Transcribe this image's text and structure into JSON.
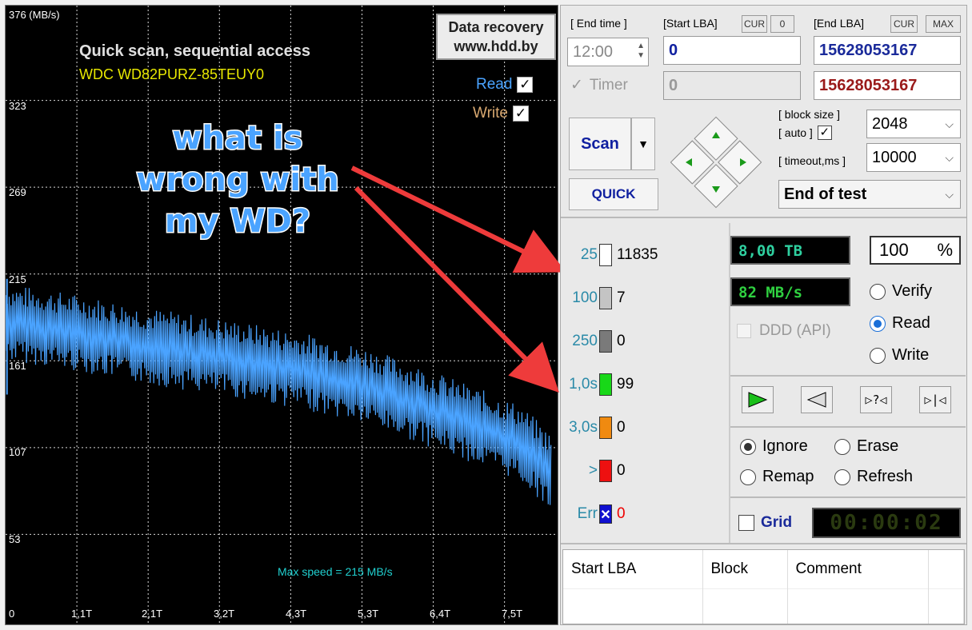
{
  "graph": {
    "y_unit_label": "376 (MB/s)",
    "y_ticks": [
      "323",
      "269",
      "215",
      "161",
      "107",
      "53"
    ],
    "x_ticks": [
      "0",
      "1,1T",
      "2,1T",
      "3,2T",
      "4,3T",
      "5,3T",
      "6,4T",
      "7,5T"
    ],
    "title": "Quick scan, sequential access",
    "model": "WDC WD82PURZ-85TEUY0",
    "brand_line1": "Data recovery",
    "brand_line2": "www.hdd.by",
    "read_label": "Read",
    "write_label": "Write",
    "check_mark": "✓",
    "max_speed": "Max speed = 215 MB/s",
    "annotation_line1": "what is",
    "annotation_line2": "wrong with",
    "annotation_line3": "my WD?",
    "colors": {
      "read_line": "#4aa3ff",
      "grid": "#ffffff",
      "annotation_arrow": "#ee3b3b"
    }
  },
  "chart_data": {
    "type": "line",
    "title": "Quick scan, sequential access",
    "xlabel": "",
    "ylabel": "MB/s",
    "ylim": [
      0,
      376
    ],
    "x_unit": "TB",
    "grid": true,
    "series": [
      {
        "name": "Read",
        "x": [
          0,
          0.5,
          1.1,
          2.1,
          3.2,
          4.3,
          5.3,
          6.4,
          7.5,
          8.0
        ],
        "y": [
          185,
          182,
          178,
          170,
          163,
          155,
          145,
          128,
          110,
          90
        ]
      }
    ]
  },
  "controls": {
    "end_time_label": "[ End time ]",
    "end_time_value": "12:00",
    "timer_label": "Timer",
    "start_lba_label": "[Start LBA]",
    "cur_label": "CUR",
    "start_zero": "0",
    "start_lba_value": "0",
    "start_lba_value2": "0",
    "end_lba_label": "[End LBA]",
    "max_label": "MAX",
    "end_lba_value": "15628053167",
    "end_lba_value2": "15628053167",
    "scan_label": "Scan",
    "quick_label": "QUICK",
    "block_size_label": "[ block size ]",
    "auto_label": "[ auto ]",
    "block_size_value": "2048",
    "timeout_label": "[ timeout,ms ]",
    "timeout_value": "10000",
    "end_action": "End of test"
  },
  "levels": [
    {
      "label": "25",
      "count": "11835",
      "color": "#ffffff"
    },
    {
      "label": "100",
      "count": "7",
      "color": "#c4c4c4"
    },
    {
      "label": "250",
      "count": "0",
      "color": "#7a7a7a"
    },
    {
      "label": "1,0s",
      "count": "99",
      "color": "#18d818"
    },
    {
      "label": "3,0s",
      "count": "0",
      "color": "#f08a10"
    },
    {
      "label": ">",
      "count": "0",
      "color": "#ee1010"
    },
    {
      "label": "Err",
      "count": "0",
      "color": "#1010d0"
    }
  ],
  "status": {
    "capacity": "8,00 TB",
    "percent": "100",
    "percent_sign": "%",
    "speed": "82 MB/s",
    "ddd_label": "DDD (API)",
    "verify": "Verify",
    "read": "Read",
    "write": "Write",
    "ignore": "Ignore",
    "erase": "Erase",
    "remap": "Remap",
    "refresh": "Refresh",
    "grid_label": "Grid",
    "timer_display": "00:00:02"
  },
  "log": {
    "columns": [
      "Start LBA",
      "Block",
      "Comment"
    ]
  }
}
